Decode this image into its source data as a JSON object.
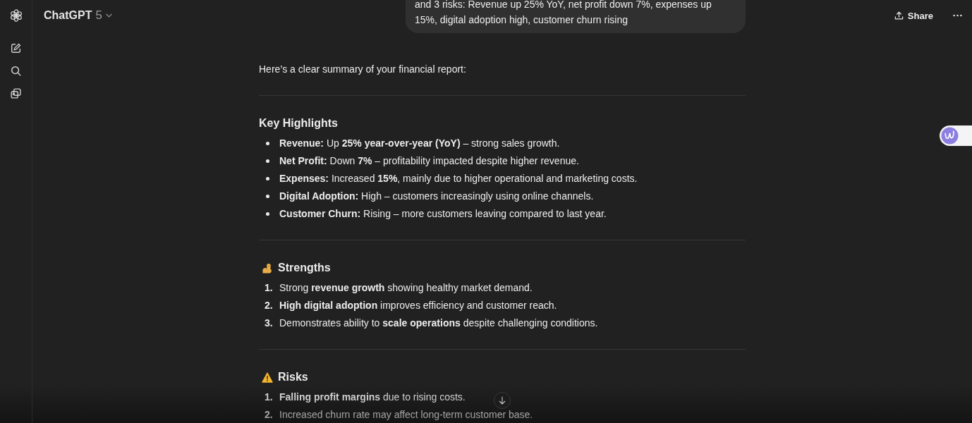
{
  "header": {
    "model_name": "ChatGPT",
    "model_version": "5",
    "share_label": "Share"
  },
  "user_message": {
    "text": "and 3 risks: Revenue up 25% YoY, net profit down 7%, expenses up 15%, digital adoption high, customer churn rising"
  },
  "reply": {
    "intro": "Here’s a clear summary of your financial report:",
    "sections": [
      {
        "kind": "plain",
        "title": "Key Highlights",
        "items": [
          {
            "text": "**Revenue:** Up **25% year-over-year (YoY)** – strong sales growth."
          },
          {
            "text": "**Net Profit:** Down **7%** – profitability impacted despite higher revenue."
          },
          {
            "text": "**Expenses:** Increased **15%**, mainly due to higher operational and marketing costs."
          },
          {
            "text": "**Digital Adoption:** High – customers increasingly using online channels."
          },
          {
            "text": "**Customer Churn:** Rising – more customers leaving compared to last year."
          }
        ]
      },
      {
        "kind": "strength",
        "title": "Strengths",
        "items": [
          {
            "number": "1.",
            "text": "Strong **revenue growth** showing healthy market demand."
          },
          {
            "number": "2.",
            "text": "**High digital adoption** improves efficiency and customer reach."
          },
          {
            "number": "3.",
            "text": "Demonstrates ability to **scale operations** despite challenging conditions."
          }
        ]
      },
      {
        "kind": "risk",
        "title": "Risks",
        "items": [
          {
            "number": "1.",
            "text": "**Falling profit margins** due to rising costs."
          },
          {
            "number": "2.",
            "text": "Increased churn rate may affect long-term customer base."
          }
        ]
      }
    ]
  }
}
